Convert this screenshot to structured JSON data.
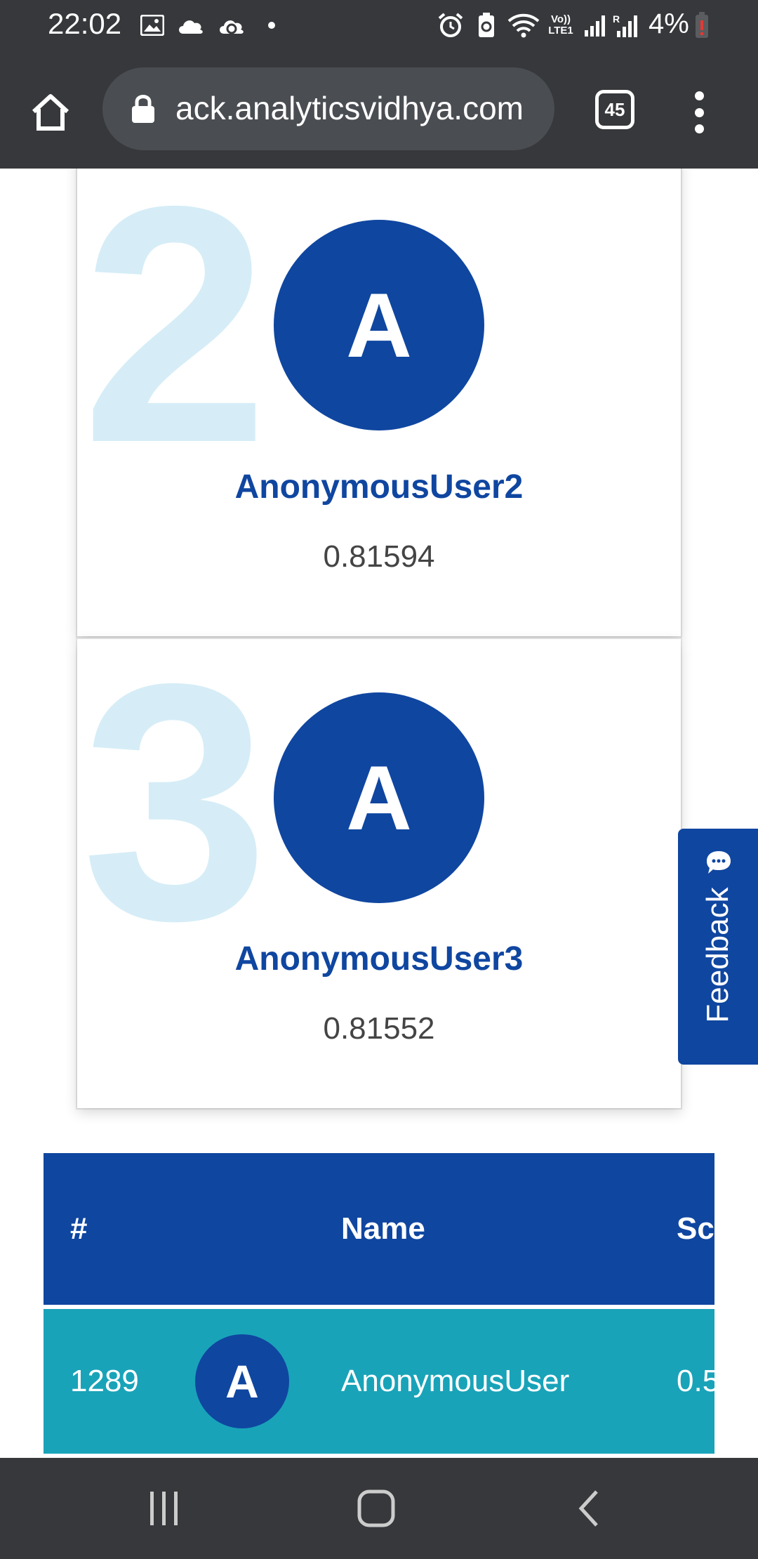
{
  "status_bar": {
    "time": "22:02",
    "battery_text": "4%",
    "icons": [
      "gallery-icon",
      "cloud-icon",
      "cloud-sync-icon",
      "dot-icon",
      "alarm-icon",
      "battery-saver-icon",
      "wifi-icon",
      "volte-icon",
      "signal-icon",
      "signal-roaming-icon",
      "battery-icon"
    ]
  },
  "browser": {
    "url": "ack.analyticsvidhya.com",
    "tab_count": "45"
  },
  "podium": [
    {
      "rank": "2",
      "avatar": "A",
      "name": "AnonymousUser2",
      "score": "0.81594"
    },
    {
      "rank": "3",
      "avatar": "A",
      "name": "AnonymousUser3",
      "score": "0.81552"
    }
  ],
  "table": {
    "headers": {
      "rank": "#",
      "name": "Name",
      "score": "Sc"
    },
    "rows": [
      {
        "rank": "1289",
        "avatar": "A",
        "name": "AnonymousUser",
        "score": "0.5"
      }
    ]
  },
  "feedback": {
    "label": "Feedback"
  },
  "colors": {
    "brand": "#0f46a0",
    "row": "#19a3b9",
    "rank_watermark": "#d6edf7",
    "chrome": "#36383b"
  }
}
